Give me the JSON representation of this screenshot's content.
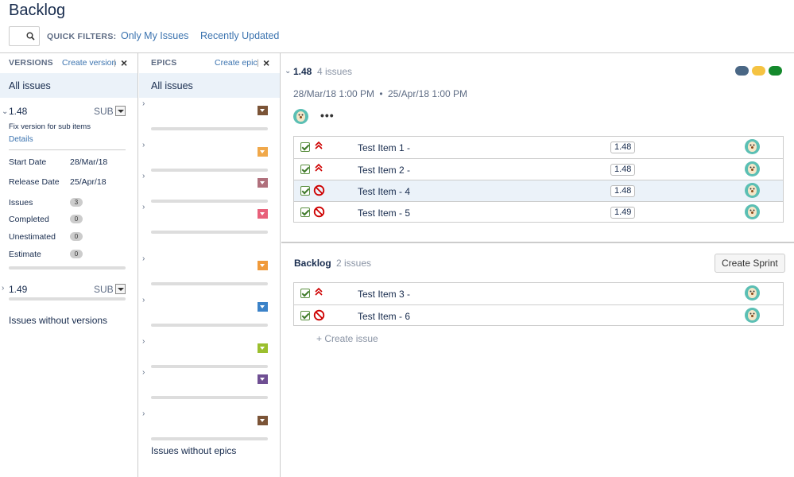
{
  "header": {
    "title": "Backlog",
    "quick_filters_label": "QUICK FILTERS:",
    "filters": [
      "Only My Issues",
      "Recently Updated"
    ]
  },
  "versions": {
    "title": "VERSIONS",
    "create_label": "Create version",
    "separator": "|",
    "close": "×",
    "all_issues": "All issues",
    "items": [
      {
        "name": "1.48",
        "sub": "SUB",
        "description": "Fix version for sub items",
        "details_link": "Details",
        "start_date_label": "Start Date",
        "start_date": "28/Mar/18",
        "release_date_label": "Release Date",
        "release_date": "25/Apr/18",
        "issues_label": "Issues",
        "issues": "3",
        "completed_label": "Completed",
        "completed": "0",
        "unestimated_label": "Unestimated",
        "unestimated": "0",
        "estimate_label": "Estimate",
        "estimate": "0"
      },
      {
        "name": "1.49",
        "sub": "SUB"
      }
    ],
    "without": "Issues without versions"
  },
  "epics": {
    "title": "EPICS",
    "create_label": "Create epic",
    "separator": "|",
    "close": "×",
    "all_issues": "All issues",
    "colors": [
      "#7b5437",
      "#f0a84a",
      "#b0707c",
      "#e8607a",
      "#f09a3a",
      "#3b82c8",
      "#9bbf2e",
      "#6f4f93",
      "#7b5437"
    ],
    "without": "Issues without epics"
  },
  "sprint": {
    "name": "1.48",
    "count": "4 issues",
    "start": "28/Mar/18 1:00 PM",
    "bullet": "•",
    "end": "25/Apr/18 1:00 PM",
    "more": "•••",
    "status_colors": [
      "#4a6785",
      "#f5c342",
      "#14892c"
    ],
    "issues": [
      {
        "summary": "Test Item 1 -",
        "version": "1.48",
        "priority": "highest-icon"
      },
      {
        "summary": "Test Item 2 -",
        "version": "1.48",
        "priority": "highest-icon"
      },
      {
        "summary": "Test Item - 4",
        "version": "1.48",
        "priority": "blocker-icon"
      },
      {
        "summary": "Test Item - 5",
        "version": "1.49",
        "priority": "blocker-icon"
      }
    ]
  },
  "backlog": {
    "name": "Backlog",
    "count": "2 issues",
    "create_sprint": "Create Sprint",
    "issues": [
      {
        "summary": "Test Item 3 -",
        "priority": "highest-icon"
      },
      {
        "summary": "Test Item - 6",
        "priority": "blocker-icon"
      }
    ],
    "create_issue": "+ Create issue"
  }
}
